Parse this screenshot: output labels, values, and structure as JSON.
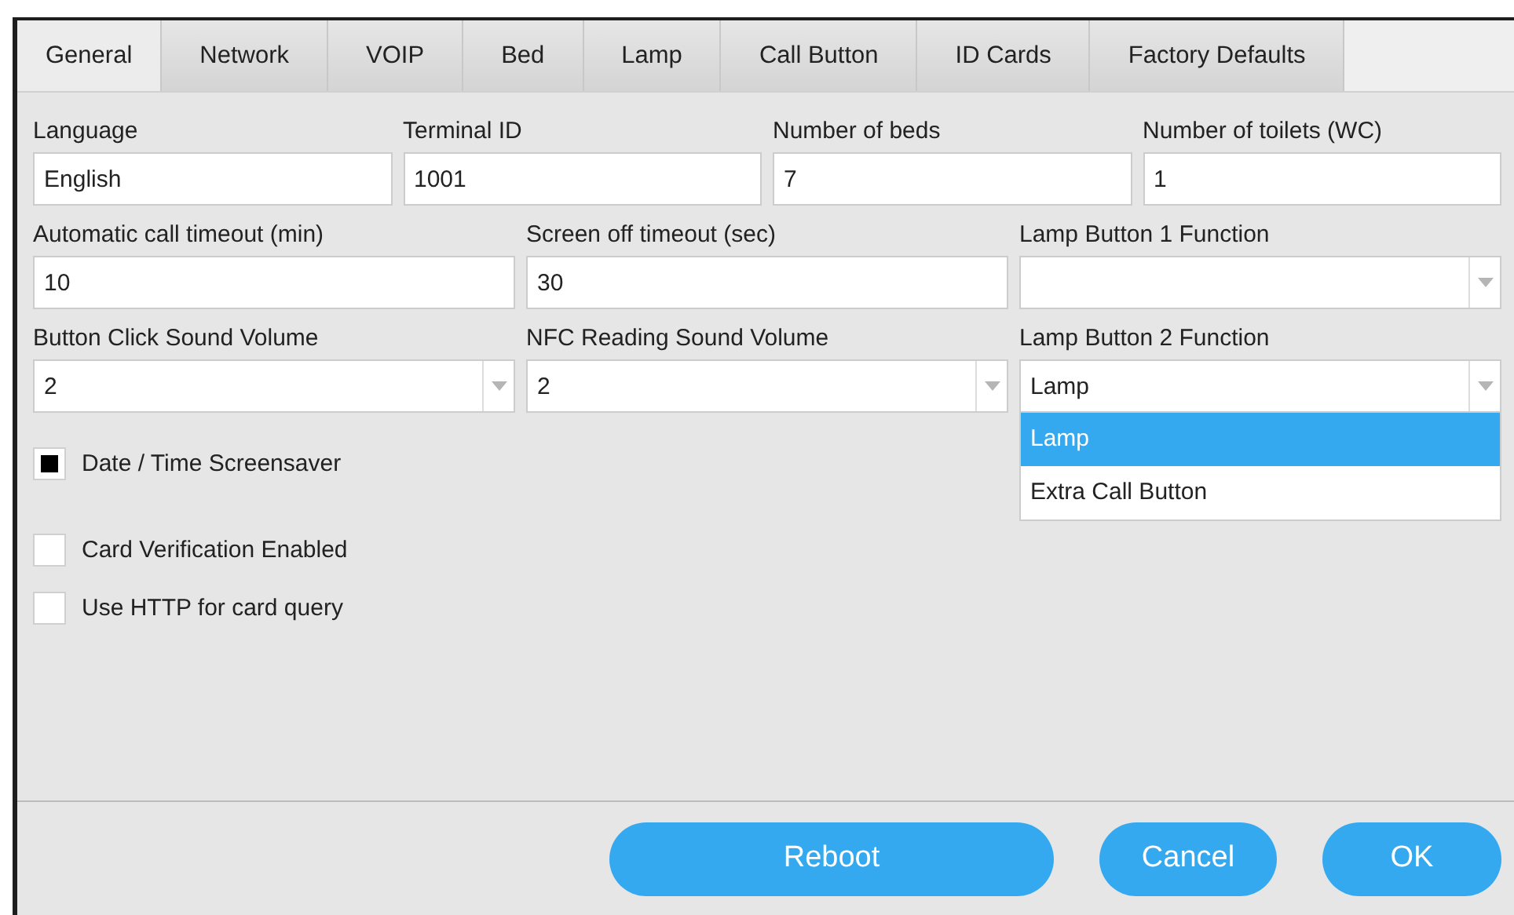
{
  "tabs": [
    {
      "label": "General",
      "selected": true
    },
    {
      "label": "Network",
      "selected": false
    },
    {
      "label": "VOIP",
      "selected": false
    },
    {
      "label": "Bed",
      "selected": false
    },
    {
      "label": "Lamp",
      "selected": false
    },
    {
      "label": "Call Button",
      "selected": false
    },
    {
      "label": "ID Cards",
      "selected": false
    },
    {
      "label": "Factory Defaults",
      "selected": false
    }
  ],
  "field_rows": [
    [
      {
        "label": "Language",
        "kind": "text",
        "value": "English"
      },
      {
        "label": "Terminal ID",
        "kind": "text",
        "value": "1001"
      },
      {
        "label": "Number of beds",
        "kind": "text",
        "value": "7"
      },
      {
        "label": "Number of toilets (WC)",
        "kind": "text",
        "value": "1"
      }
    ],
    [
      {
        "label": "Automatic call timeout (min)",
        "kind": "text",
        "value": "10"
      },
      {
        "label": "Screen off timeout (sec)",
        "kind": "text",
        "value": "30"
      },
      {
        "label": "Lamp Button 1 Function",
        "kind": "select"
      }
    ],
    [
      {
        "label": "Button Click Sound Volume",
        "kind": "select",
        "value": "2"
      },
      {
        "label": "NFC Reading Sound Volume",
        "kind": "select",
        "value": "2"
      },
      {
        "label": "Lamp Button 2 Function",
        "kind": "select",
        "value": "Lamp",
        "expanded": true,
        "options": [
          {
            "label": "Lamp",
            "selected": true
          },
          {
            "label": "Extra Call Button",
            "selected": false
          }
        ]
      }
    ]
  ],
  "checkboxes": [
    {
      "label": "Date / Time Screensaver",
      "checked": true
    },
    {
      "label": "Card Verification Enabled",
      "checked": false
    },
    {
      "label": "Use HTTP for card query",
      "checked": false
    }
  ],
  "buttons": [
    "Reboot",
    "Cancel",
    "OK"
  ]
}
